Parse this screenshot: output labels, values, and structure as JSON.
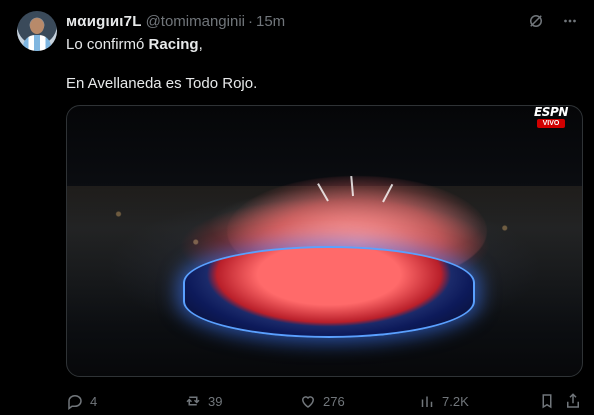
{
  "tweet": {
    "author": {
      "display_name": "мαиgιиι7L",
      "handle": "@tomimanginii",
      "separator": "·",
      "time": "15m"
    },
    "text": {
      "line1_prefix": "Lo confirmó ",
      "line1_bold": "Racing",
      "line1_suffix": ",",
      "line2": "En Avellaneda es Todo Rojo."
    },
    "media": {
      "watermark_brand": "ESPN",
      "watermark_badge": "VIVO"
    },
    "actions": {
      "replies": "4",
      "retweets": "39",
      "likes": "276",
      "views": "7.2K"
    }
  },
  "icons": {
    "reply": "reply-icon",
    "retweet": "retweet-icon",
    "like": "heart-icon",
    "views": "views-icon",
    "bookmark": "bookmark-icon",
    "share": "share-icon",
    "grok": "grok-icon",
    "more": "more-icon"
  },
  "colors": {
    "background": "#000000",
    "text": "#e7e9ea",
    "muted": "#71767b",
    "border": "#2f3336",
    "espn_red": "#d00000"
  }
}
